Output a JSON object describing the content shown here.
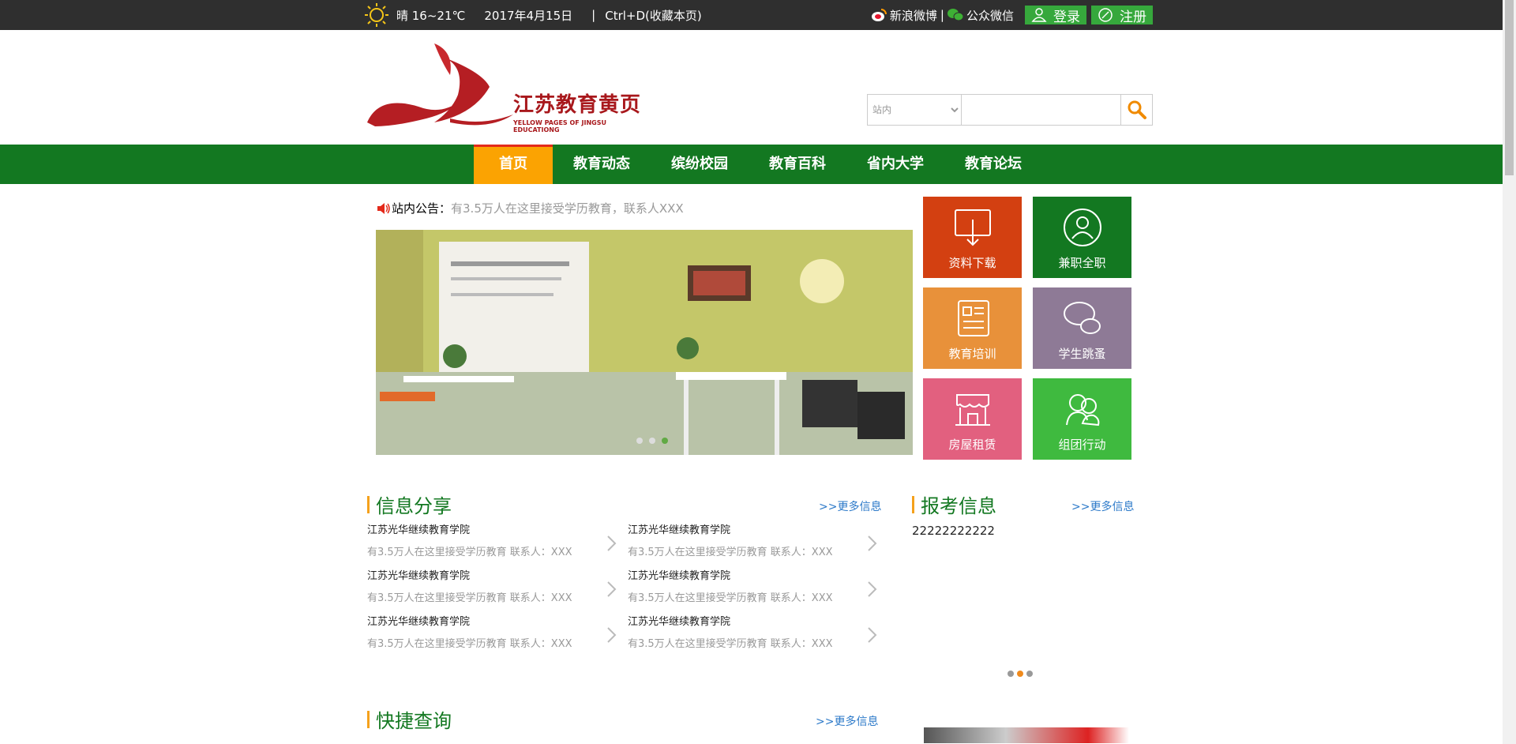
{
  "topbar": {
    "weather": "晴 16~21℃",
    "date": "2017年4月15日",
    "separator": "|",
    "bookmark": "Ctrl+D(收藏本页)",
    "weibo": "新浪微博",
    "divider": "|",
    "wechat": "公众微信",
    "login": "登录",
    "register": "注册"
  },
  "logo": {
    "cn": "江苏教育黄页",
    "en": "YELLOW PAGES OF JINGSU EDUCATIONG"
  },
  "search": {
    "scope": "站内",
    "placeholder": ""
  },
  "nav": [
    "首页",
    "教育动态",
    "缤纷校园",
    "教育百科",
    "省内大学",
    "教育论坛"
  ],
  "notice": {
    "label": "站内公告：",
    "message": "有3.5万人在这里接受学历教育，联系人XXX"
  },
  "tiles": [
    {
      "label": "资料下载",
      "color": "#d34011"
    },
    {
      "label": "兼职全职",
      "color": "#137821"
    },
    {
      "label": "教育培训",
      "color": "#e8913a"
    },
    {
      "label": "学生跳蚤",
      "color": "#8e7a96"
    },
    {
      "label": "房屋租赁",
      "color": "#e2607f"
    },
    {
      "label": "组团行动",
      "color": "#3fba3f"
    }
  ],
  "info_section": {
    "title": "信息分享",
    "more": ">>更多信息",
    "items": [
      {
        "title": "江苏光华继续教育学院",
        "desc": "有3.5万人在这里接受学历教育 联系人：XXX"
      },
      {
        "title": "江苏光华继续教育学院",
        "desc": "有3.5万人在这里接受学历教育 联系人：XXX"
      },
      {
        "title": "江苏光华继续教育学院",
        "desc": "有3.5万人在这里接受学历教育 联系人：XXX"
      },
      {
        "title": "江苏光华继续教育学院",
        "desc": "有3.5万人在这里接受学历教育 联系人：XXX"
      },
      {
        "title": "江苏光华继续教育学院",
        "desc": "有3.5万人在这里接受学历教育 联系人：XXX"
      },
      {
        "title": "江苏光华继续教育学院",
        "desc": "有3.5万人在这里接受学历教育 联系人：XXX"
      }
    ]
  },
  "exam_section": {
    "title": "报考信息",
    "more": ">>更多信息",
    "content": "22222222222"
  },
  "quick_section": {
    "title": "快捷查询",
    "more": ">>更多信息"
  }
}
